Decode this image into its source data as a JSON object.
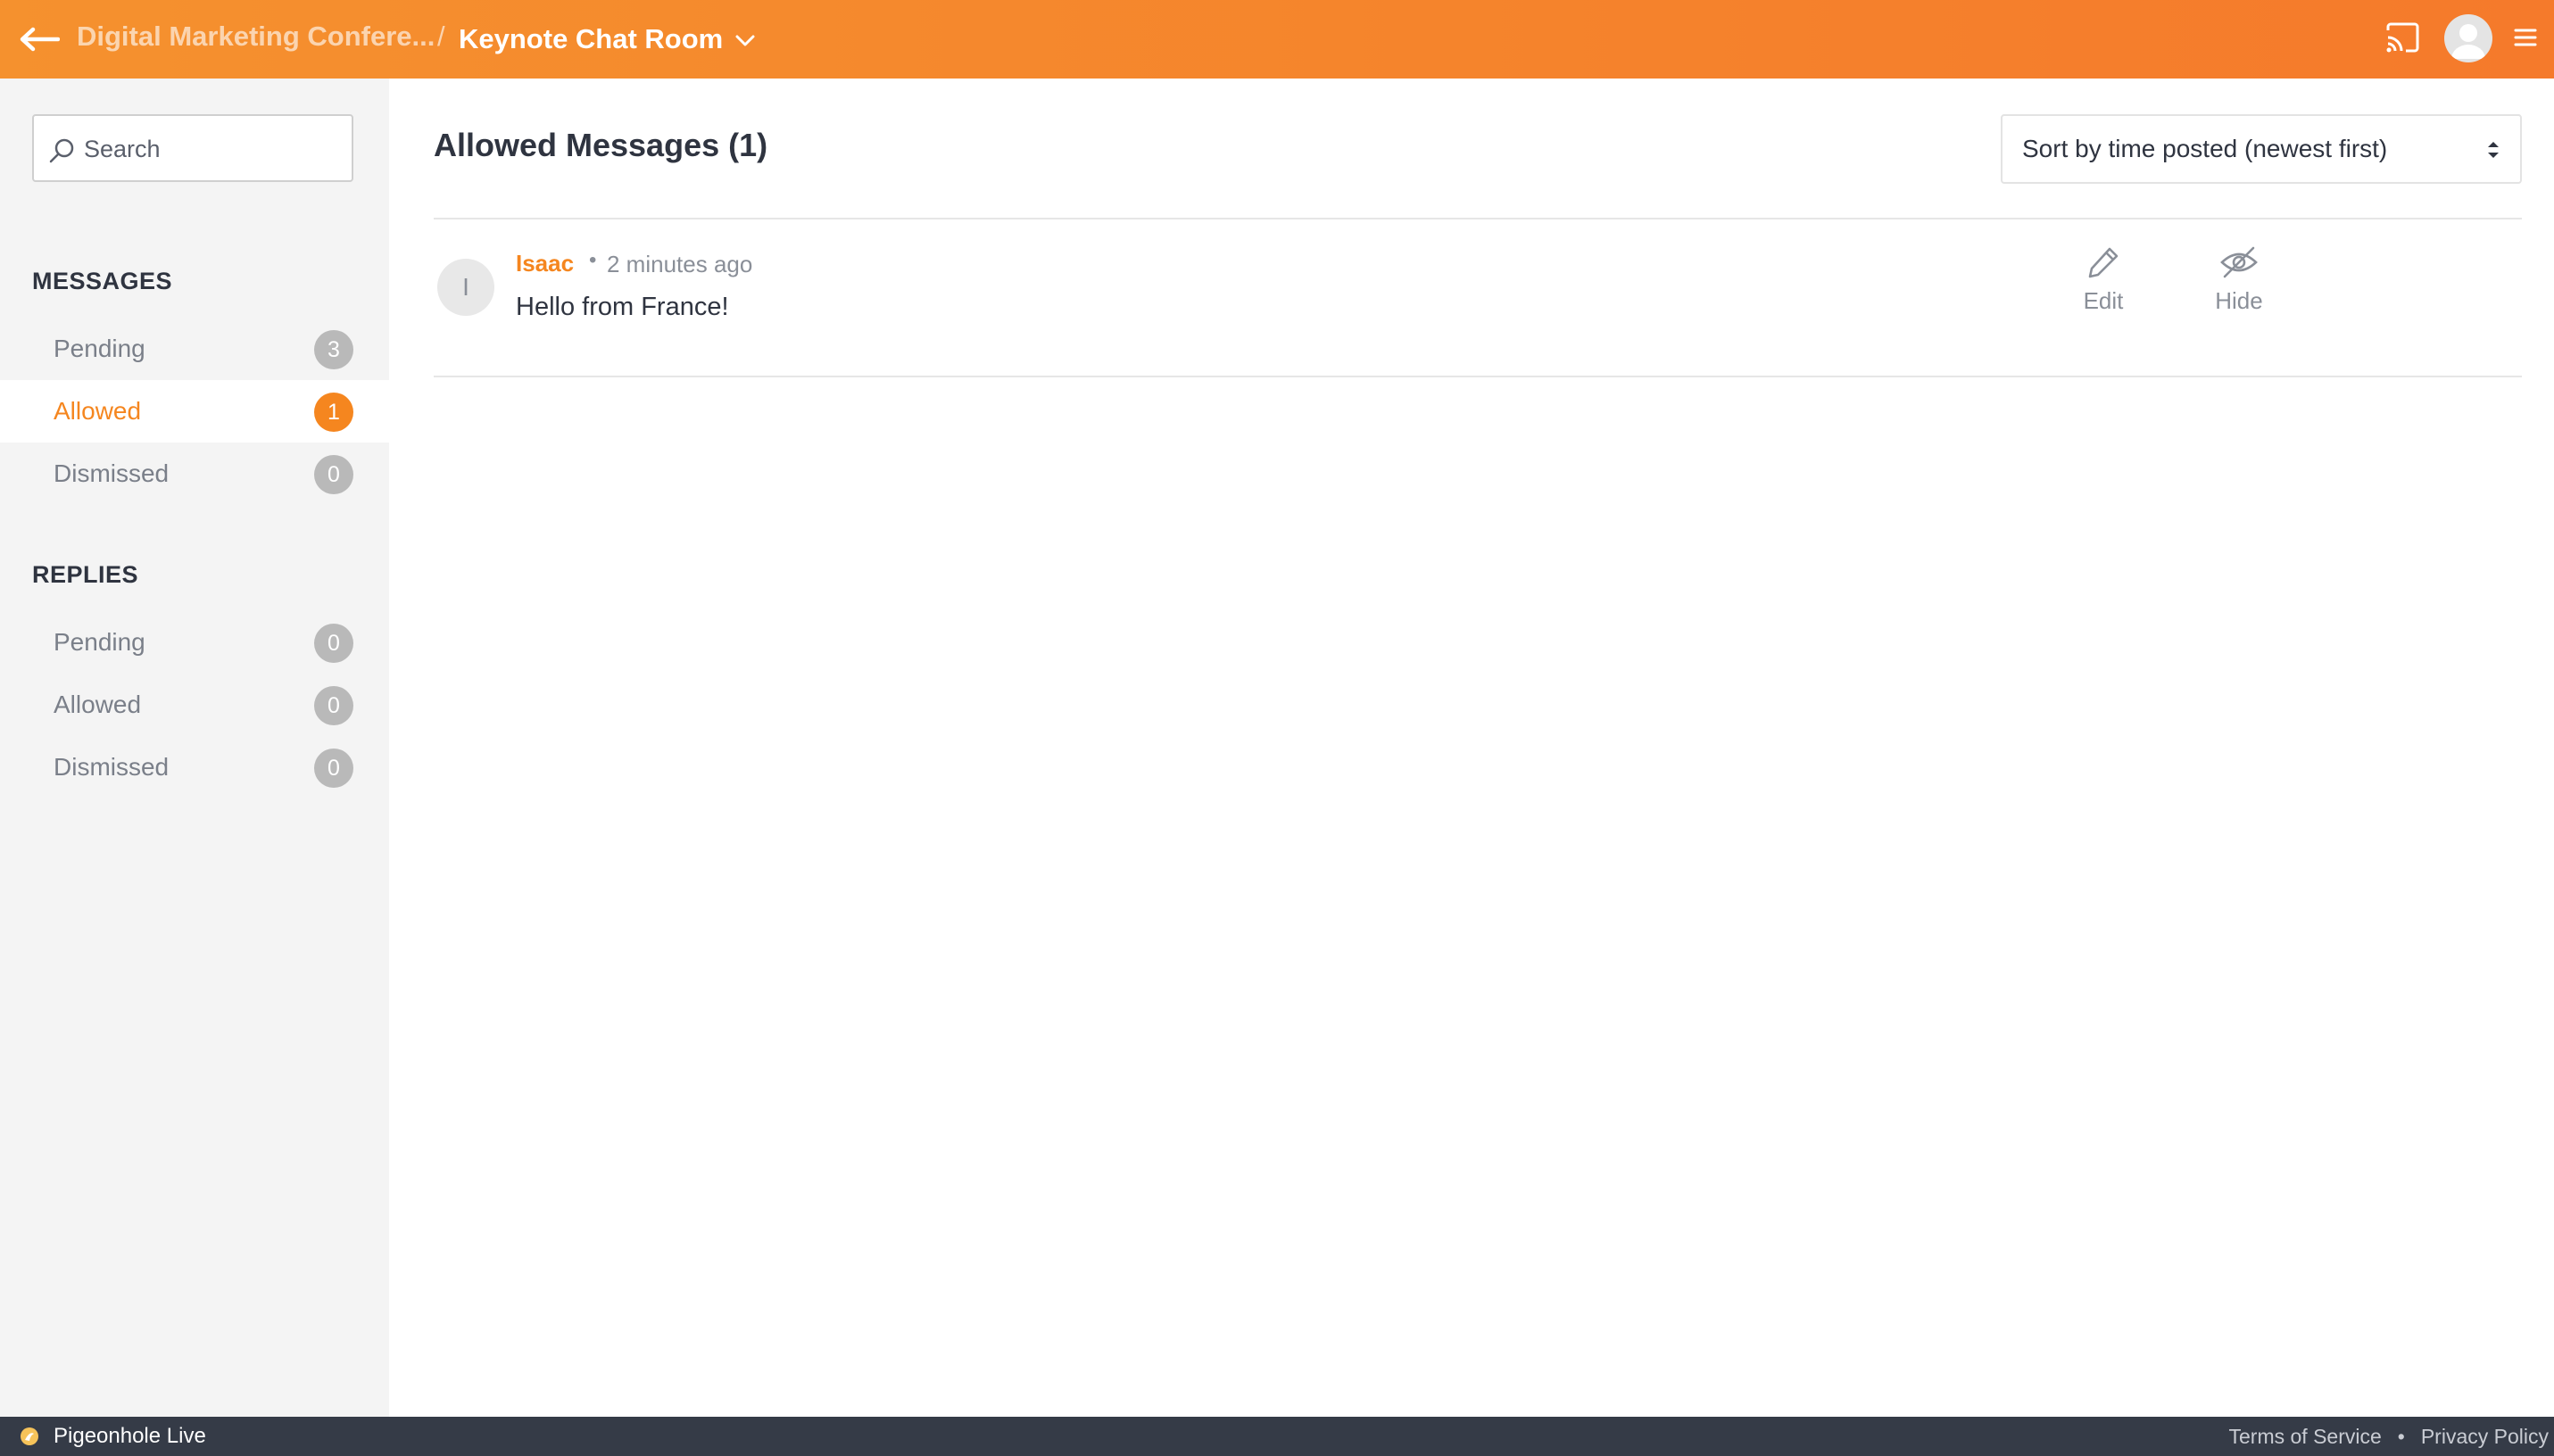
{
  "header": {
    "event_title": "Digital Marketing Confere...",
    "separator": "/",
    "room_title": "Keynote Chat Room",
    "icons": {
      "back": "arrow-left-icon",
      "chevron": "chevron-down-icon",
      "cast": "cast-icon",
      "avatar": "user-avatar-icon",
      "menu": "hamburger-menu-icon"
    }
  },
  "sidebar": {
    "search": {
      "placeholder": "Search",
      "value": ""
    },
    "sections": [
      {
        "title": "MESSAGES",
        "items": [
          {
            "label": "Pending",
            "count": "3",
            "active": false
          },
          {
            "label": "Allowed",
            "count": "1",
            "active": true
          },
          {
            "label": "Dismissed",
            "count": "0",
            "active": false
          }
        ]
      },
      {
        "title": "REPLIES",
        "items": [
          {
            "label": "Pending",
            "count": "0",
            "active": false
          },
          {
            "label": "Allowed",
            "count": "0",
            "active": false
          },
          {
            "label": "Dismissed",
            "count": "0",
            "active": false
          }
        ]
      }
    ]
  },
  "main": {
    "title": "Allowed Messages (1)",
    "sort": {
      "selected": "Sort by time posted (newest first)"
    },
    "messages": [
      {
        "avatar_initial": "I",
        "author": "Isaac",
        "dot": "•",
        "time": "2 minutes ago",
        "body": "Hello from France!",
        "actions": {
          "edit": "Edit",
          "hide": "Hide"
        }
      }
    ]
  },
  "footer": {
    "brand": "Pigeonhole Live",
    "links": {
      "terms": "Terms of Service",
      "dot": "•",
      "privacy": "Privacy Policy"
    }
  },
  "colors": {
    "accent": "#f5861f",
    "header_start": "#f5912e",
    "header_end": "#f57a2b",
    "footer_bg": "#353b47",
    "badge_inactive": "#b9b9b9"
  }
}
